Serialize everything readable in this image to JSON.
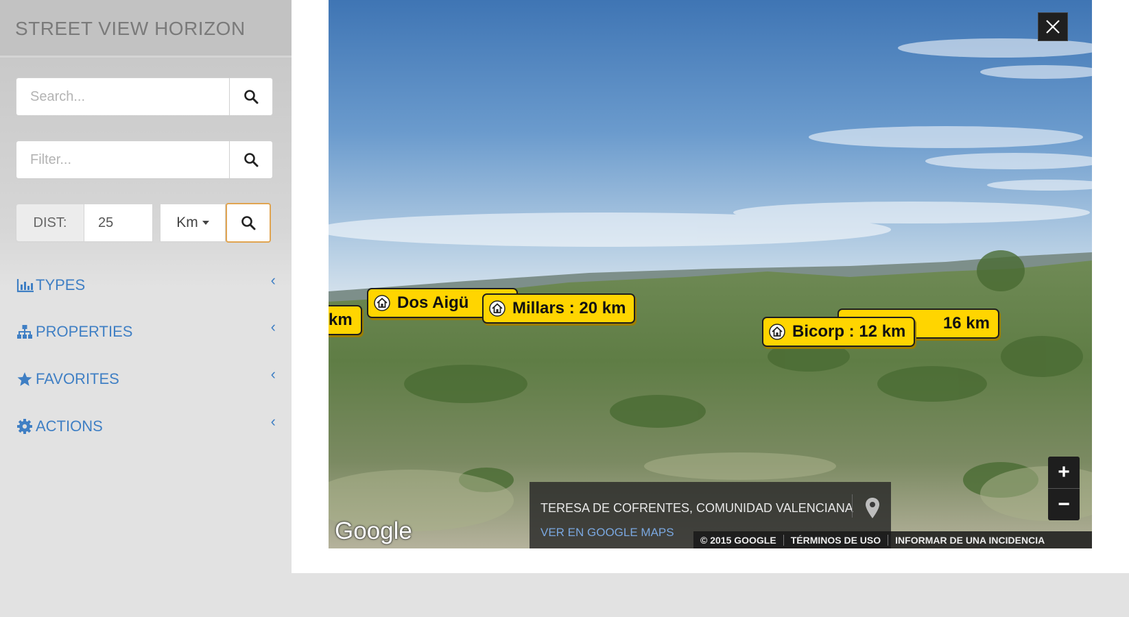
{
  "app": {
    "title": "STREET VIEW HORIZON"
  },
  "sidebar": {
    "search": {
      "placeholder": "Search..."
    },
    "filter": {
      "placeholder": "Filter..."
    },
    "distance": {
      "label": "DIST:",
      "value": "25",
      "unit": "Km"
    },
    "menu": [
      {
        "label": "TYPES",
        "icon": "bar-chart-icon"
      },
      {
        "label": "PROPERTIES",
        "icon": "sitemap-icon"
      },
      {
        "label": "FAVORITES",
        "icon": "star-icon"
      },
      {
        "label": "ACTIONS",
        "icon": "gear-icon"
      }
    ],
    "chevron": "‹"
  },
  "streetview": {
    "tags": [
      {
        "label": "km"
      },
      {
        "label": "Dos Aigü"
      },
      {
        "label": "Millars : 20 km"
      },
      {
        "label": "16 km"
      },
      {
        "label": "Bicorp : 12 km"
      }
    ],
    "address": "TERESA DE COFRENTES, COMUNIDAD VALENCIANA",
    "maps_link": "VER EN GOOGLE MAPS",
    "footer": [
      "© 2015 GOOGLE",
      "TÉRMINOS DE USO",
      "INFORMAR DE UNA INCIDENCIA"
    ],
    "logo": "Google",
    "zoom_in": "+",
    "zoom_out": "−"
  },
  "colors": {
    "accent": "#3f7fc4",
    "tag": "#ffd500",
    "focus": "#e0a450"
  }
}
